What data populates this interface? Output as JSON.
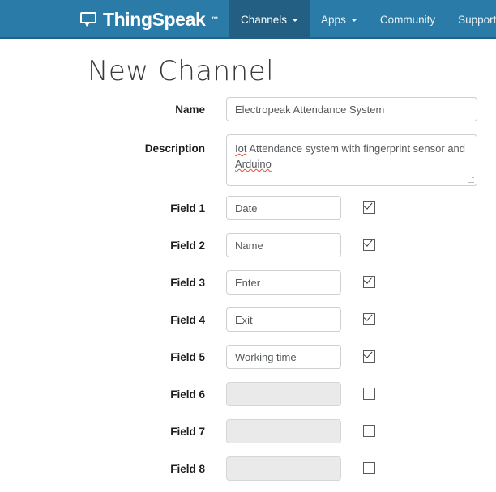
{
  "header": {
    "brand": {
      "name": "ThingSpeak",
      "trademark": "™",
      "icon": "speech-bubble-icon"
    },
    "nav": [
      {
        "label": "Channels",
        "has_caret": true,
        "active": true
      },
      {
        "label": "Apps",
        "has_caret": true,
        "active": false
      },
      {
        "label": "Community",
        "has_caret": false,
        "active": false
      },
      {
        "label": "Support",
        "has_caret": false,
        "active": false
      }
    ],
    "colors": {
      "bar": "#2b7ba9",
      "active_item": "#235f82",
      "border_bottom": "#20638a",
      "text": "#ffffff"
    }
  },
  "page": {
    "title": "New Channel"
  },
  "form": {
    "name": {
      "label": "Name",
      "value": "Electropeak Attendance System",
      "placeholder": ""
    },
    "description": {
      "label": "Description",
      "value_part1": "Iot",
      "value_part2": " Attendance system with fingerprint sensor and ",
      "value_part3": "Arduino",
      "value": "Iot Attendance system with fingerprint sensor and Arduino",
      "placeholder": "",
      "misspelled": [
        "Iot",
        "Arduino"
      ]
    },
    "fields": [
      {
        "label": "Field 1",
        "value": "Date",
        "checked": true,
        "enabled": true
      },
      {
        "label": "Field 2",
        "value": "Name",
        "checked": true,
        "enabled": true
      },
      {
        "label": "Field 3",
        "value": "Enter",
        "checked": true,
        "enabled": true
      },
      {
        "label": "Field 4",
        "value": "Exit",
        "checked": true,
        "enabled": true
      },
      {
        "label": "Field 5",
        "value": "Working time",
        "checked": true,
        "enabled": true
      },
      {
        "label": "Field 6",
        "value": "",
        "checked": false,
        "enabled": false
      },
      {
        "label": "Field 7",
        "value": "",
        "checked": false,
        "enabled": false
      },
      {
        "label": "Field 8",
        "value": "",
        "checked": false,
        "enabled": false
      }
    ]
  }
}
